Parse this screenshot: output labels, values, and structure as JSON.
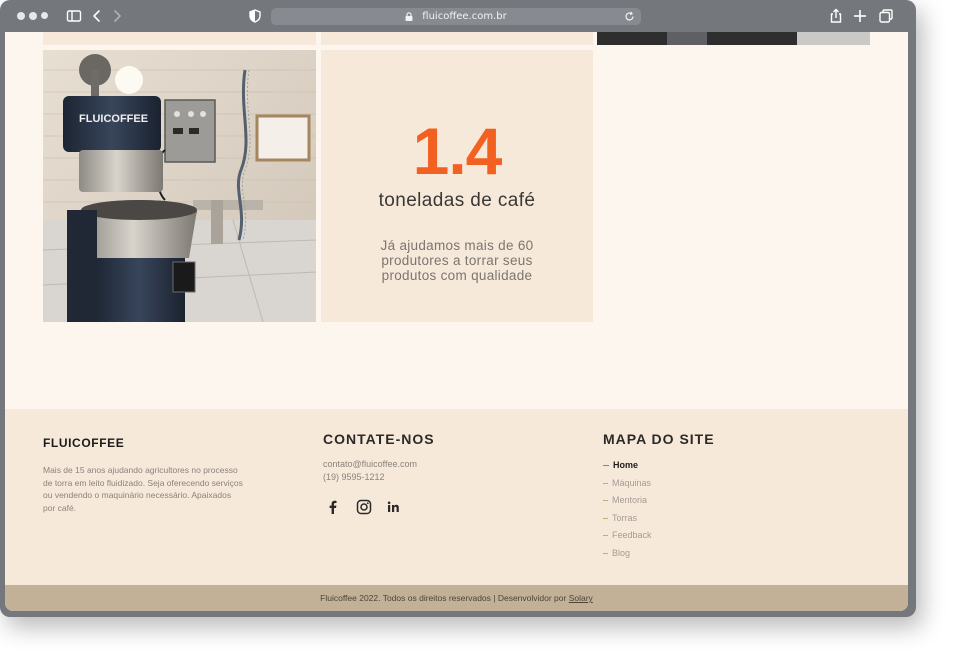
{
  "browser": {
    "url": "fluicoffee.com.br"
  },
  "stat": {
    "number": "1.4",
    "label": "toneladas de café",
    "description": "Já ajudamos mais de 60 produtores a torrar seus produtos com qualidade"
  },
  "photo": {
    "brand_text": "FLUICOFFEE"
  },
  "footer": {
    "logo": "FLUICOFFEE",
    "about": "Mais de 15 anos ajudando agricultores no processo de torra em leito fluidizado. Seja oferecendo serviços ou vendendo o maquinário necessário. Apaixados por café.",
    "contact": {
      "title": "CONTATE-NOS",
      "email": "contato@fluicoffee.com",
      "phone": "(19) 9595-1212",
      "social": [
        "facebook-icon",
        "instagram-icon",
        "linkedin-icon"
      ]
    },
    "sitemap": {
      "title": "MAPA DO SITE",
      "items": [
        "Home",
        "Máquinas",
        "Mentoria",
        "Torras",
        "Feedback",
        "Blog"
      ],
      "active": "Home"
    },
    "copyright": "Fluicoffee 2022. Todos os direitos reservados | Desenvolvidor por",
    "developer": "Solary"
  },
  "colors": {
    "accent": "#f26122",
    "background": "#fdf6ee",
    "card": "#f7e9da",
    "bottom_bar": "#c2b196"
  }
}
